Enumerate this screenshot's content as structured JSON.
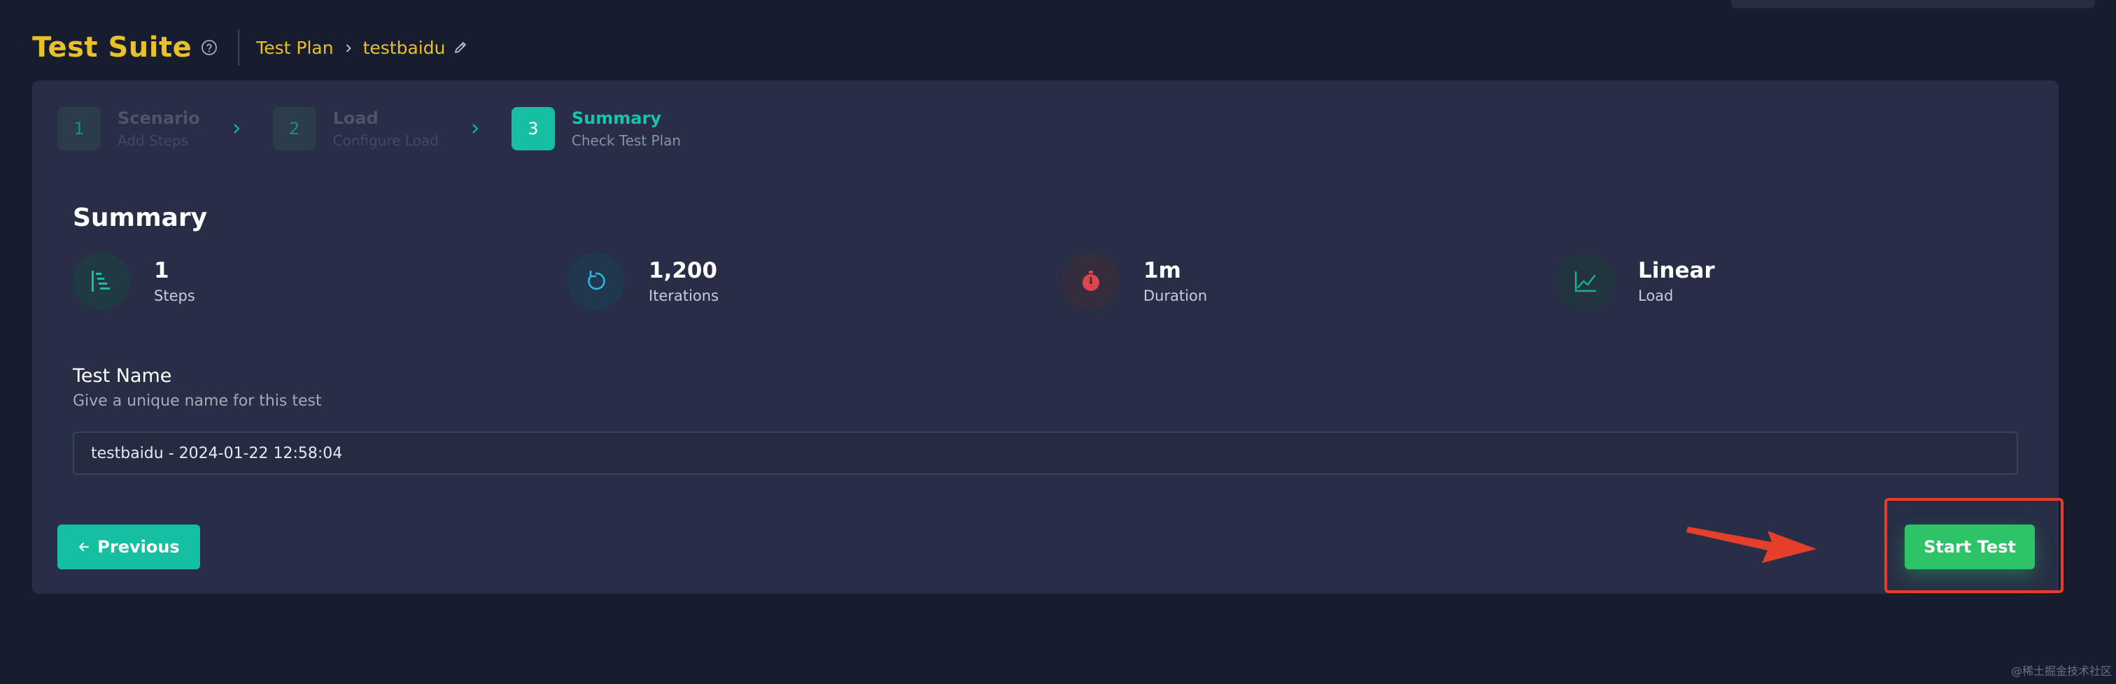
{
  "header": {
    "title": "Test Suite",
    "breadcrumb": [
      "Test Plan",
      "testbaidu"
    ]
  },
  "steps": [
    {
      "number": "1",
      "title": "Scenario",
      "subtitle": "Add Steps",
      "active": false
    },
    {
      "number": "2",
      "title": "Load",
      "subtitle": "Configure Load",
      "active": false
    },
    {
      "number": "3",
      "title": "Summary",
      "subtitle": "Check Test Plan",
      "active": true
    }
  ],
  "summary": {
    "title": "Summary",
    "stats": [
      {
        "value": "1",
        "label": "Steps",
        "icon": "steps-list-icon",
        "color": "#15bfa0"
      },
      {
        "value": "1,200",
        "label": "Iterations",
        "icon": "refresh-icon",
        "color": "#2fb3e0"
      },
      {
        "value": "1m",
        "label": "Duration",
        "icon": "stopwatch-icon",
        "color": "#e0454f"
      },
      {
        "value": "Linear",
        "label": "Load",
        "icon": "line-chart-icon",
        "color": "#19b38a"
      }
    ]
  },
  "test_name": {
    "label": "Test Name",
    "help": "Give a unique name for this test",
    "value": "testbaidu - 2024-01-22 12:58:04"
  },
  "actions": {
    "previous_label": "Previous",
    "start_label": "Start Test"
  },
  "watermark": "@稀土掘金技术社区",
  "colors": {
    "accent_teal": "#15bfa0",
    "start_green": "#2dc468",
    "title_yellow": "#e8c02a",
    "annotation_red": "#e53e2b"
  }
}
